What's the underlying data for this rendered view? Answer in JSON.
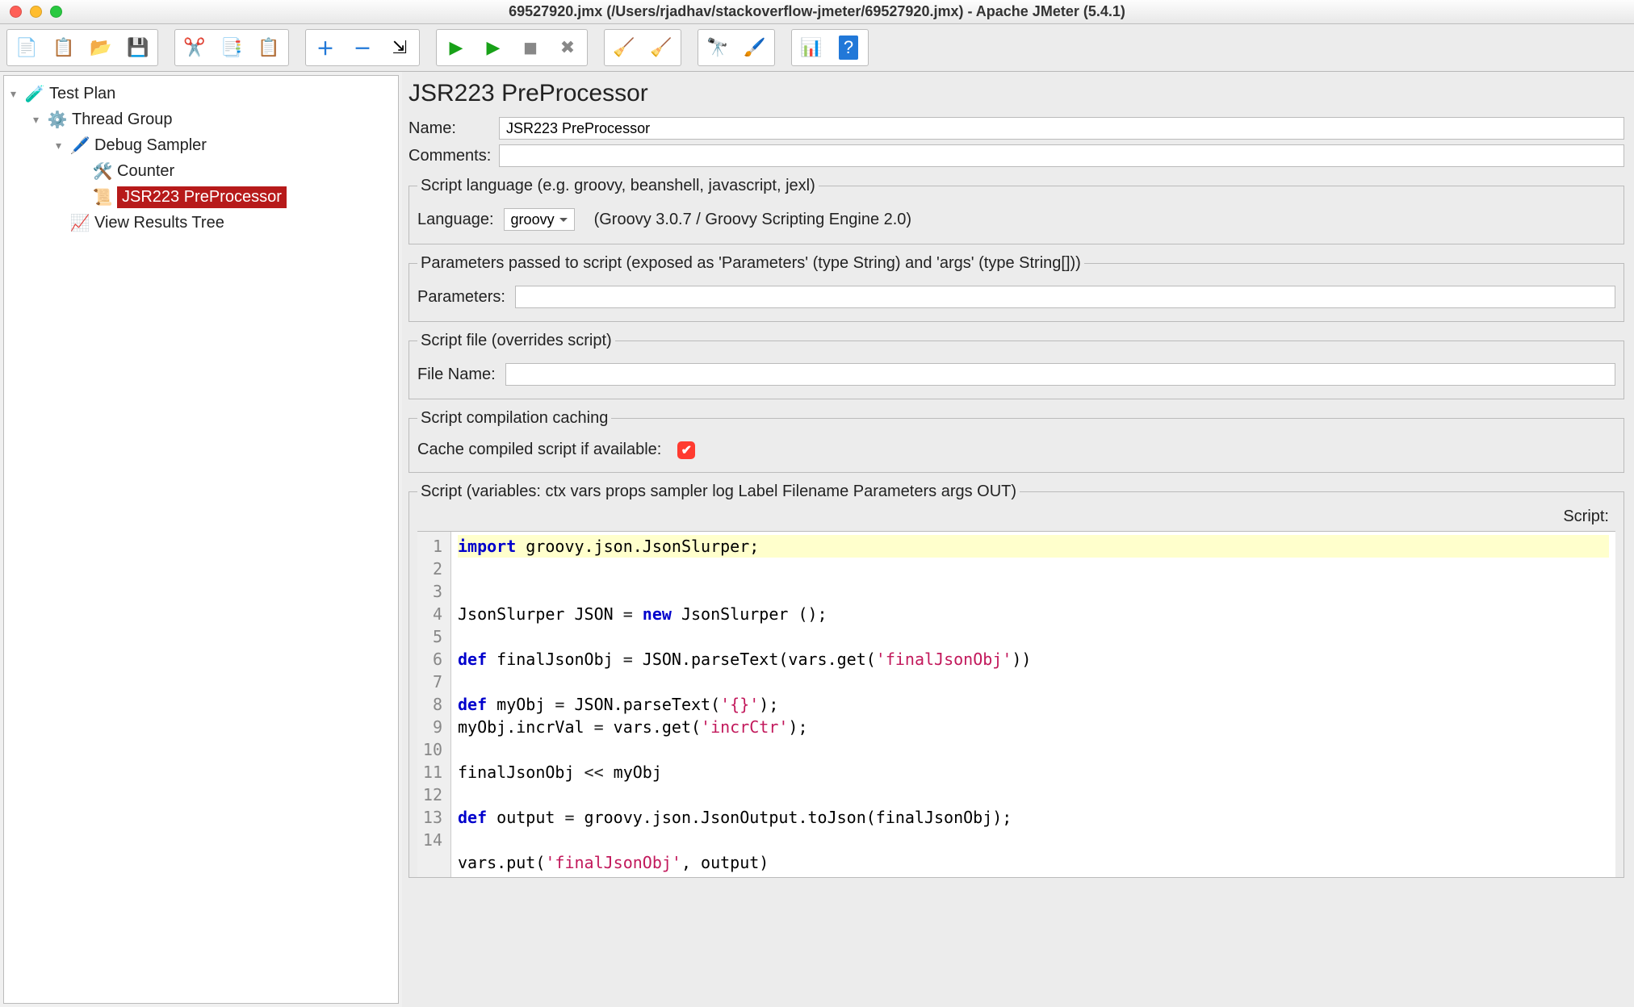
{
  "window": {
    "title": "69527920.jmx (/Users/rjadhav/stackoverflow-jmeter/69527920.jmx) - Apache JMeter (5.4.1)"
  },
  "tree": {
    "test_plan": "Test Plan",
    "thread_group": "Thread Group",
    "debug_sampler": "Debug Sampler",
    "counter": "Counter",
    "jsr223": "JSR223 PreProcessor",
    "view_results": "View Results Tree"
  },
  "panel": {
    "heading": "JSR223 PreProcessor",
    "name_label": "Name:",
    "name_value": "JSR223 PreProcessor",
    "comments_label": "Comments:",
    "lang_fieldset": "Script language (e.g. groovy, beanshell, javascript, jexl)",
    "language_label": "Language:",
    "language_value": "groovy",
    "language_desc": "(Groovy 3.0.7 / Groovy Scripting Engine 2.0)",
    "params_fieldset": "Parameters passed to script (exposed as 'Parameters' (type String) and 'args' (type String[]))",
    "parameters_label": "Parameters:",
    "file_fieldset": "Script file (overrides script)",
    "file_name_label": "File Name:",
    "cache_fieldset": "Script compilation caching",
    "cache_label": "Cache compiled script if available:",
    "script_fieldset": "Script (variables: ctx vars props sampler log Label Filename Parameters args OUT)",
    "script_sublabel": "Script:"
  },
  "code": {
    "l1_t1": "import",
    "l1_t2": " groovy.json.JsonSlurper;",
    "l3_t1": "JsonSlurper JSON ",
    "l3_t2": "=",
    "l3_t3": " ",
    "l3_t4": "new",
    "l3_t5": " JsonSlurper ();",
    "l5_t1": "def",
    "l5_t2": " finalJsonObj ",
    "l5_t3": "=",
    "l5_t4": " JSON.parseText(vars.get(",
    "l5_t5": "'finalJsonObj'",
    "l5_t6": "))",
    "l7_t1": "def",
    "l7_t2": " myObj ",
    "l7_t3": "=",
    "l7_t4": " JSON.parseText(",
    "l7_t5": "'{}'",
    "l7_t6": ");",
    "l8_t1": "myObj.incrVal ",
    "l8_t2": "=",
    "l8_t3": " vars.get(",
    "l8_t4": "'incrCtr'",
    "l8_t5": ");",
    "l10_t1": "finalJsonObj ",
    "l10_t2": "<<",
    "l10_t3": " myObj",
    "l12_t1": "def",
    "l12_t2": " output ",
    "l12_t3": "=",
    "l12_t4": " groovy.json.JsonOutput.toJson(finalJsonObj);",
    "l14_t1": "vars.put(",
    "l14_t2": "'finalJsonObj'",
    "l14_t3": ", output)",
    "n1": "1",
    "n2": "2",
    "n3": "3",
    "n4": "4",
    "n5": "5",
    "n6": "6",
    "n7": "7",
    "n8": "8",
    "n9": "9",
    "n10": "10",
    "n11": "11",
    "n12": "12",
    "n13": "13",
    "n14": "14"
  }
}
